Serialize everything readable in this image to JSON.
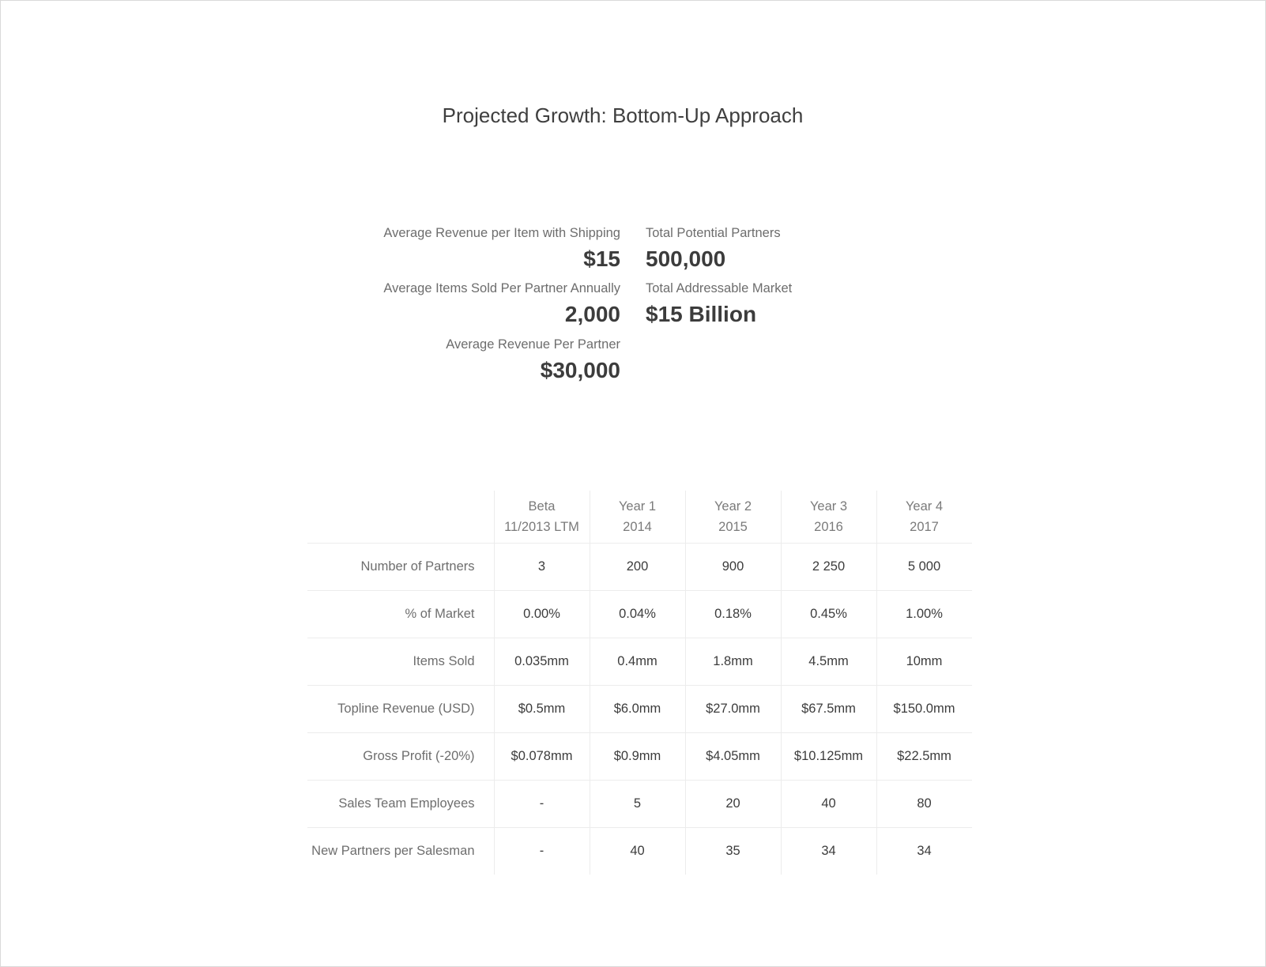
{
  "title": "Projected Growth: Bottom-Up Approach",
  "metrics": {
    "left": [
      {
        "label": "Average Revenue per Item with Shipping",
        "value": "$15"
      },
      {
        "label": "Average Items Sold Per Partner Annually",
        "value": "2,000"
      },
      {
        "label": "Average Revenue Per Partner",
        "value": "$30,000"
      }
    ],
    "right": [
      {
        "label": "Total Potential Partners",
        "value": "500,000"
      },
      {
        "label": "Total Addressable Market",
        "value": "$15 Billion"
      }
    ]
  },
  "table": {
    "columns": [
      {
        "line1": "Beta",
        "line2": "11/2013 LTM"
      },
      {
        "line1": "Year 1",
        "line2": "2014"
      },
      {
        "line1": "Year 2",
        "line2": "2015"
      },
      {
        "line1": "Year 3",
        "line2": "2016"
      },
      {
        "line1": "Year 4",
        "line2": "2017"
      }
    ],
    "rows": [
      {
        "label": "Number of Partners",
        "values": [
          "3",
          "200",
          "900",
          "2 250",
          "5 000"
        ]
      },
      {
        "label": "% of Market",
        "values": [
          "0.00%",
          "0.04%",
          "0.18%",
          "0.45%",
          "1.00%"
        ]
      },
      {
        "label": "Items Sold",
        "values": [
          "0.035mm",
          "0.4mm",
          "1.8mm",
          "4.5mm",
          "10mm"
        ]
      },
      {
        "label": "Topline Revenue (USD)",
        "values": [
          "$0.5mm",
          "$6.0mm",
          "$27.0mm",
          "$67.5mm",
          "$150.0mm"
        ]
      },
      {
        "label": "Gross Profit (-20%)",
        "values": [
          "$0.078mm",
          "$0.9mm",
          "$4.05mm",
          "$10.125mm",
          "$22.5mm"
        ]
      },
      {
        "label": "Sales Team Employees",
        "values": [
          "-",
          "5",
          "20",
          "40",
          "80"
        ]
      },
      {
        "label": "New Partners per Salesman",
        "values": [
          "-",
          "40",
          "35",
          "34",
          "34"
        ]
      }
    ]
  }
}
